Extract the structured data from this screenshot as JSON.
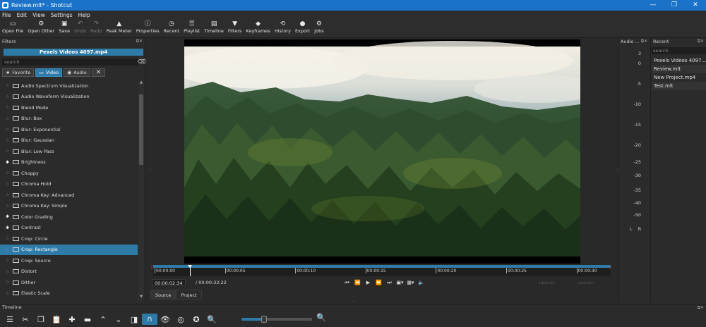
{
  "window": {
    "title": "Review.mlt* - Shotcut",
    "controls": {
      "minimize": "—",
      "maximize": "❐",
      "close": "✕"
    }
  },
  "menu": [
    "File",
    "Edit",
    "View",
    "Settings",
    "Help"
  ],
  "toolbar": [
    {
      "label": "Open File",
      "icon": "open-file-icon",
      "glyph": "▭"
    },
    {
      "label": "Open Other",
      "icon": "open-other-icon",
      "glyph": "⚙"
    },
    {
      "label": "Save",
      "icon": "save-icon",
      "glyph": "▣"
    },
    {
      "label": "Undo",
      "icon": "undo-icon",
      "glyph": "↶",
      "disabled": true
    },
    {
      "label": "Redo",
      "icon": "redo-icon",
      "glyph": "↷",
      "disabled": true
    },
    {
      "label": "Peak Meter",
      "icon": "peak-meter-icon",
      "glyph": "▲"
    },
    {
      "label": "Properties",
      "icon": "properties-icon",
      "glyph": "ⓘ"
    },
    {
      "label": "Recent",
      "icon": "recent-icon",
      "glyph": "◷"
    },
    {
      "label": "Playlist",
      "icon": "playlist-icon",
      "glyph": "☰"
    },
    {
      "label": "Timeline",
      "icon": "timeline-icon",
      "glyph": "▤"
    },
    {
      "label": "Filters",
      "icon": "filters-icon",
      "glyph": "▼"
    },
    {
      "label": "Keyframes",
      "icon": "keyframes-icon",
      "glyph": "◆"
    },
    {
      "label": "History",
      "icon": "history-icon",
      "glyph": "⟲"
    },
    {
      "label": "Export",
      "icon": "export-icon",
      "glyph": "●"
    },
    {
      "label": "Jobs",
      "icon": "jobs-icon",
      "glyph": "⚙"
    }
  ],
  "filters": {
    "title": "Filters",
    "clip": "Pexels Videos 4097.mp4",
    "search_placeholder": "search",
    "tabs": [
      {
        "label": "Favorite",
        "glyph": "★",
        "active": false
      },
      {
        "label": "Video",
        "glyph": "▭",
        "active": true
      },
      {
        "label": "Audio",
        "glyph": "◉",
        "active": false
      }
    ],
    "items": [
      {
        "name": "Audio Spectrum Visualization",
        "fav": false
      },
      {
        "name": "Audio Waveform Visualization",
        "fav": false
      },
      {
        "name": "Blend Mode",
        "fav": false
      },
      {
        "name": "Blur: Box",
        "fav": false
      },
      {
        "name": "Blur: Exponential",
        "fav": false
      },
      {
        "name": "Blur: Gaussian",
        "fav": false
      },
      {
        "name": "Blur: Low Pass",
        "fav": false
      },
      {
        "name": "Brightness",
        "fav": true
      },
      {
        "name": "Choppy",
        "fav": false
      },
      {
        "name": "Chroma Hold",
        "fav": false
      },
      {
        "name": "Chroma Key: Advanced",
        "fav": false
      },
      {
        "name": "Chroma Key: Simple",
        "fav": false
      },
      {
        "name": "Color Grading",
        "fav": true
      },
      {
        "name": "Contrast",
        "fav": true
      },
      {
        "name": "Crop: Circle",
        "fav": false
      },
      {
        "name": "Crop: Rectangle",
        "fav": false,
        "selected": true
      },
      {
        "name": "Crop: Source",
        "fav": false
      },
      {
        "name": "Distort",
        "fav": false
      },
      {
        "name": "Dither",
        "fav": false
      },
      {
        "name": "Elastic Scale",
        "fav": false
      }
    ]
  },
  "player": {
    "ruler": [
      "00:00:00",
      "00:00:05",
      "00:00:10",
      "00:00:15",
      "00:00:20",
      "00:00:25",
      "00:00:30"
    ],
    "current_time": "00:00:02:34",
    "duration": "/ 00:00:32:22",
    "in_point": "--:--:--:--",
    "out_point": "--:--:--:--",
    "tabs": [
      "Source",
      "Project"
    ]
  },
  "audio": {
    "title": "Audio ...",
    "scale": [
      "3",
      "0",
      "-5",
      "-10",
      "-15",
      "-20",
      "-25",
      "-30",
      "-35",
      "-40",
      "-50"
    ],
    "channels": "L R"
  },
  "recent": {
    "title": "Recent",
    "search_placeholder": "search",
    "items": [
      "Pexels Videos 4097...",
      "Review.mlt",
      "New Project.mp4",
      "Test.mlt"
    ]
  },
  "timeline": {
    "title": "Timeline"
  }
}
